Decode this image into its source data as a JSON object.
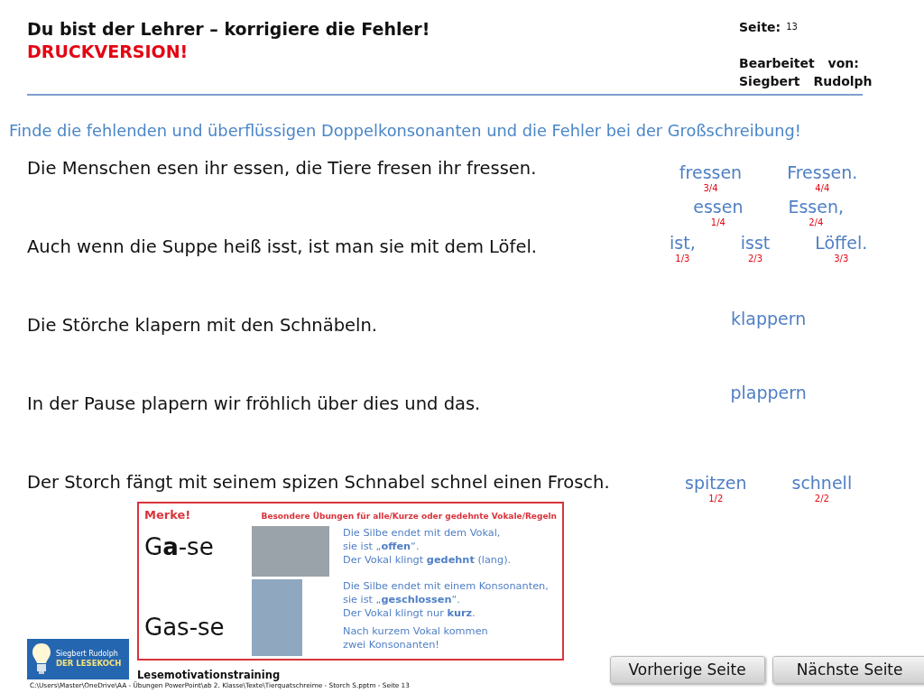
{
  "header": {
    "title": "Du bist der Lehrer – korrigiere die Fehler!",
    "subtitle": "DRUCKVERSION!",
    "page_label": "Seite:",
    "page_number": "13",
    "edited_label": "Bearbeitet von:",
    "author": "Siegbert Rudolph"
  },
  "instruction": "Finde die fehlenden und überflüssigen Doppelkonsonanten und die Fehler bei der Großschreibung!",
  "sentences": [
    "Die Menschen esen ihr essen, die Tiere fresen ihr fressen.",
    "Auch wenn die Suppe heiß isst, ist man sie mit dem Löfel.",
    "Die Störche klapern mit den Schnäbeln.",
    "In der Pause plapern wir fröhlich über dies und das.",
    "Der Storch fängt mit seinem spizen Schnabel schnel einen Frosch."
  ],
  "answer_lines": [
    [
      {
        "word": "fressen",
        "fraction": "3/4"
      },
      {
        "word": "Fressen.",
        "fraction": "4/4"
      }
    ],
    [
      {
        "word": "essen",
        "fraction": "1/4"
      },
      {
        "word": "Essen,",
        "fraction": "2/4"
      }
    ],
    [
      {
        "word": "ist,",
        "fraction": "1/3"
      },
      {
        "word": "isst",
        "fraction": "2/3"
      },
      {
        "word": "Löffel.",
        "fraction": "3/3"
      }
    ],
    [
      {
        "word": "klappern"
      }
    ],
    [
      {
        "word": "plappern"
      }
    ],
    [
      {
        "word": "spitzen",
        "fraction": "1/2"
      },
      {
        "word": "schnell",
        "fraction": "2/2"
      }
    ]
  ],
  "merke": {
    "title": "Merke!",
    "heading": "Besondere Übungen für alle/Kurze oder gedehnte Vokale/Regeln",
    "rows": [
      {
        "syllables": "G**a**-se",
        "texts": [
          "Die Silbe endet mit dem Vokal,\nsie ist „**offen**“.\nDer Vokal klingt **gedehnt** (lang)."
        ]
      },
      {
        "syllables": "Gas-se",
        "texts": [
          "Die Silbe endet mit einem Konsonanten,\nsie ist „**geschlossen**“.\nDer Vokal klingt nur **kurz**.",
          "Nach kurzem Vokal kommen\nzwei Konsonanten!"
        ]
      }
    ]
  },
  "logo": {
    "name": "Siegbert Rudolph",
    "brand": "DER LESEKOCH"
  },
  "course": "Lesemotivationstraining",
  "file_path": "C:\\Users\\Master\\OneDrive\\AA - Übungen PowerPoint\\ab 2. Klasse\\Texte\\Tierquatschreime - Storch S.pptm - Seite 13",
  "buttons": [
    "Vorherige Seite",
    "Nächste Seite"
  ]
}
